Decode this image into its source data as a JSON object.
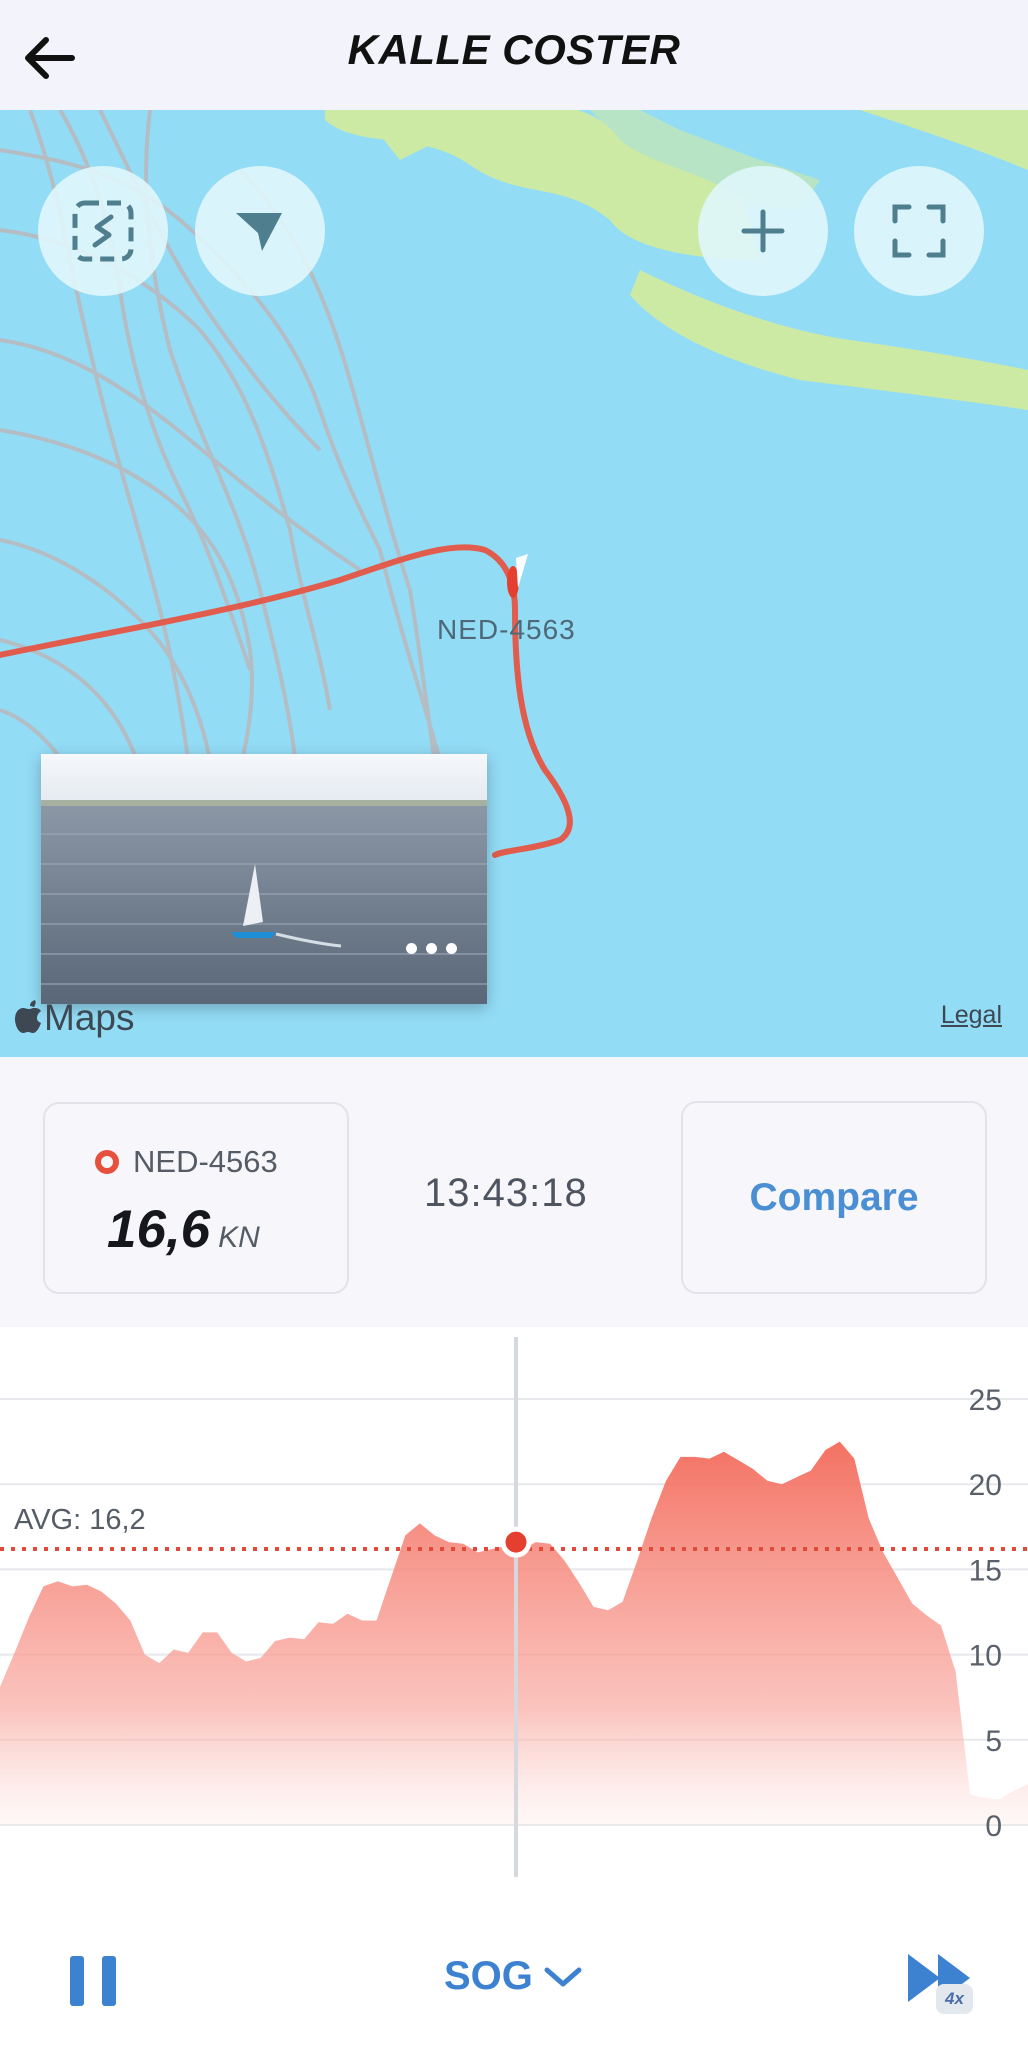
{
  "header": {
    "title": "KALLE COSTER",
    "back_icon": "arrow-left-icon"
  },
  "map": {
    "boat_label": "NED-4563",
    "attribution": "Maps",
    "legal_label": "Legal",
    "buttons": [
      "follow-track-icon",
      "navigate-arrow-icon",
      "zoom-plus-icon",
      "fullscreen-icon"
    ],
    "colors": {
      "water": "#93dcf6",
      "land": "#cdeaa5",
      "track": "#e15c4c"
    }
  },
  "info": {
    "boat_name": "NED-4563",
    "speed_value": "16,6",
    "speed_unit": "KN",
    "time": "13:43:18",
    "compare_label": "Compare"
  },
  "chart_data": {
    "type": "area",
    "avg_label": "AVG: 16,2",
    "avg_value": 16.2,
    "current_value": 16.6,
    "y_ticks": [
      "25",
      "20",
      "15",
      "10",
      "5",
      "0"
    ],
    "ylim": [
      0,
      25
    ],
    "grid": true,
    "color": "#f36a5a",
    "values": [
      8.1,
      10.1,
      12.2,
      14.0,
      14.3,
      14.0,
      14.1,
      13.7,
      13.0,
      12.0,
      10.0,
      9.5,
      10.3,
      10.1,
      11.3,
      11.3,
      10.1,
      9.6,
      9.8,
      10.8,
      11.0,
      10.9,
      11.9,
      11.8,
      12.4,
      12.0,
      12.0,
      14.5,
      17.0,
      17.7,
      17.0,
      16.6,
      16.5,
      16.0,
      16.2,
      16.4,
      16.1,
      16.6,
      16.5,
      15.5,
      14.2,
      12.8,
      12.6,
      13.1,
      15.5,
      18.0,
      20.2,
      21.6,
      21.6,
      21.5,
      21.9,
      21.4,
      20.9,
      20.2,
      20.0,
      20.4,
      20.8,
      22.0,
      22.5,
      21.5,
      18.0,
      16.0,
      14.5,
      13.0,
      12.3,
      11.7,
      9.0,
      1.8,
      1.6,
      1.5,
      2.0,
      2.4
    ]
  },
  "controls": {
    "pause_icon": "pause-icon",
    "metric_label": "SOG",
    "metric_icon": "chevron-down-icon",
    "speed_icon": "fast-forward-icon",
    "speed_badge": "4x"
  }
}
